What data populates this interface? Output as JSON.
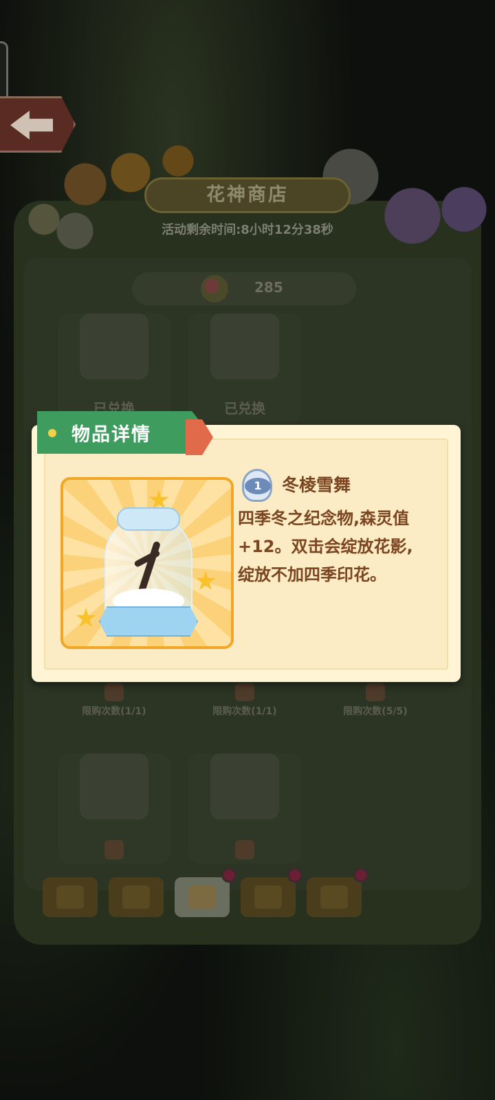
{
  "shop": {
    "title": "花神商店",
    "timer": "活动剩余时间:8小时12分38秒",
    "currency_amount": "285",
    "items_row1": [
      {
        "status": "已兑换",
        "icon": "flower-basket-icon"
      },
      {
        "status": "已兑换",
        "icon": "purple-orb-icon"
      }
    ],
    "limits_row": [
      {
        "label": "限购次数(1/1)"
      },
      {
        "label": "限购次数(1/1)"
      },
      {
        "label": "限购次数(5/5)"
      }
    ],
    "items_row3": [
      {
        "icon": "flower-basket-icon"
      },
      {
        "icon": "golden-bow-icon"
      }
    ]
  },
  "tabs": [
    {
      "icon": "ranking-tab-icon",
      "has_dot": false,
      "active": false
    },
    {
      "icon": "pinwheel-tab-icon",
      "has_dot": false,
      "active": false
    },
    {
      "icon": "shop-tab-icon",
      "has_dot": true,
      "active": true
    },
    {
      "icon": "hourglass-tab-icon",
      "has_dot": true,
      "active": false
    },
    {
      "icon": "gift-tab-icon",
      "has_dot": true,
      "active": false
    }
  ],
  "popup": {
    "header": "物品详情",
    "item_level": "1",
    "item_name": "冬棱雪舞",
    "item_desc": "四季冬之纪念物,森灵值+12。双击会绽放花影,绽放不加四季印花。",
    "item_icon": "snow-tree-jar-icon"
  },
  "colors": {
    "ribbon": "#3e9c5f",
    "popup_bg": "#fff4d4",
    "frame_border": "#f2a626",
    "text_brown": "#7a4520"
  }
}
